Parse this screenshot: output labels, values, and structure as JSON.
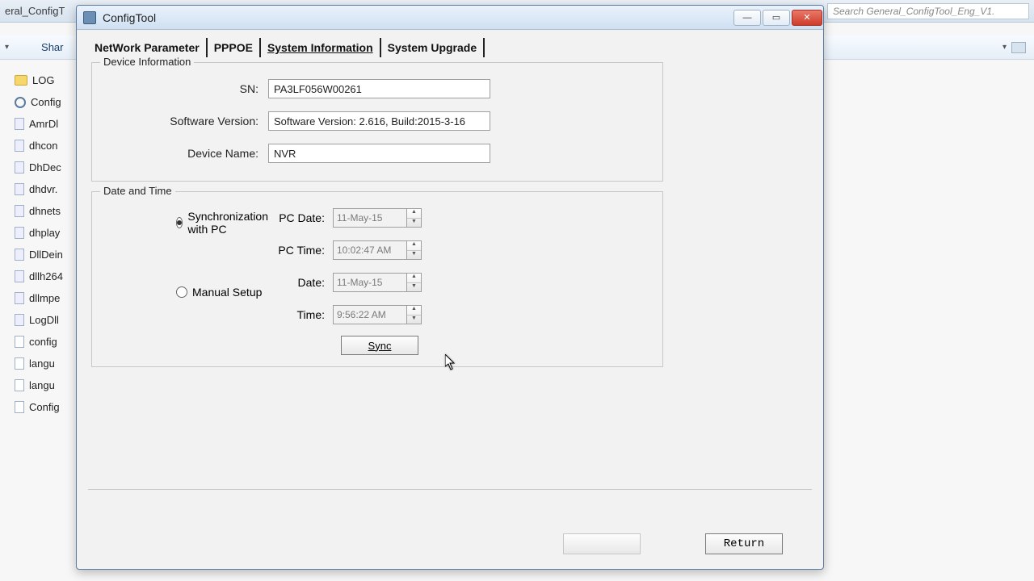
{
  "explorer": {
    "title_partial": "eral_ConfigT",
    "search_placeholder": "Search General_ConfigTool_Eng_V1.",
    "share_label": "Shar",
    "files": [
      {
        "name": "LOG",
        "icon": "folder"
      },
      {
        "name": "Config",
        "icon": "gear"
      },
      {
        "name": "AmrDl",
        "icon": "dll"
      },
      {
        "name": "dhcon",
        "icon": "dll"
      },
      {
        "name": "DhDec",
        "icon": "dll"
      },
      {
        "name": "dhdvr.",
        "icon": "dll"
      },
      {
        "name": "dhnets",
        "icon": "dll"
      },
      {
        "name": "dhplay",
        "icon": "dll"
      },
      {
        "name": "DllDein",
        "icon": "dll"
      },
      {
        "name": "dllh264",
        "icon": "dll"
      },
      {
        "name": "dllmpe",
        "icon": "dll"
      },
      {
        "name": "LogDll",
        "icon": "dll"
      },
      {
        "name": "config",
        "icon": "file"
      },
      {
        "name": "langu",
        "icon": "file"
      },
      {
        "name": "langu",
        "icon": "file"
      },
      {
        "name": "Config",
        "icon": "file"
      }
    ]
  },
  "window": {
    "title": "ConfigTool"
  },
  "tabs": [
    "NetWork Parameter",
    "PPPOE",
    "System Information",
    "System Upgrade"
  ],
  "active_tab": 2,
  "device_info": {
    "legend": "Device Information",
    "sn_label": "SN:",
    "sn_value": "PA3LF056W00261",
    "swver_label": "Software Version:",
    "swver_value": "Software Version: 2.616, Build:2015-3-16",
    "dname_label": "Device Name:",
    "dname_value": "NVR"
  },
  "datetime": {
    "legend": "Date and Time",
    "sync_radio": "Synchronization with PC",
    "manual_radio": "Manual Setup",
    "selected": "sync",
    "pc_date_label": "PC Date:",
    "pc_date_value": "11-May-15",
    "pc_time_label": "PC Time:",
    "pc_time_value": "10:02:47 AM",
    "date_label": "Date:",
    "date_value": "11-May-15",
    "time_label": "Time:",
    "time_value": "9:56:22 AM",
    "sync_button": "Sync"
  },
  "footer": {
    "apply": "",
    "return": "Return"
  }
}
